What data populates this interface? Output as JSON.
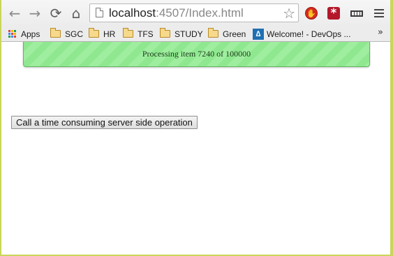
{
  "browser": {
    "address_bar": {
      "host": "localhost",
      "rest": ":4507/Index.html"
    },
    "icons": {
      "back": "back-arrow-icon",
      "forward": "forward-arrow-icon",
      "reload": "reload-icon",
      "home": "home-icon",
      "star": "star-icon",
      "menu": "menu-icon"
    }
  },
  "bookmarks": [
    {
      "label": "Apps",
      "icon": "apps-icon"
    },
    {
      "label": "SGC",
      "icon": "folder-icon"
    },
    {
      "label": "HR",
      "icon": "folder-icon"
    },
    {
      "label": "TFS",
      "icon": "folder-icon"
    },
    {
      "label": "STUDY",
      "icon": "folder-icon"
    },
    {
      "label": "Green",
      "icon": "folder-icon"
    },
    {
      "label": "Welcome! - DevOps ...",
      "icon": "devops-icon"
    }
  ],
  "page": {
    "progress": {
      "text": "Processing item 7240 of 100000",
      "current": 7240,
      "total": 100000,
      "color": "#8fe88f"
    },
    "button_label": "Call a time consuming server side operation"
  }
}
